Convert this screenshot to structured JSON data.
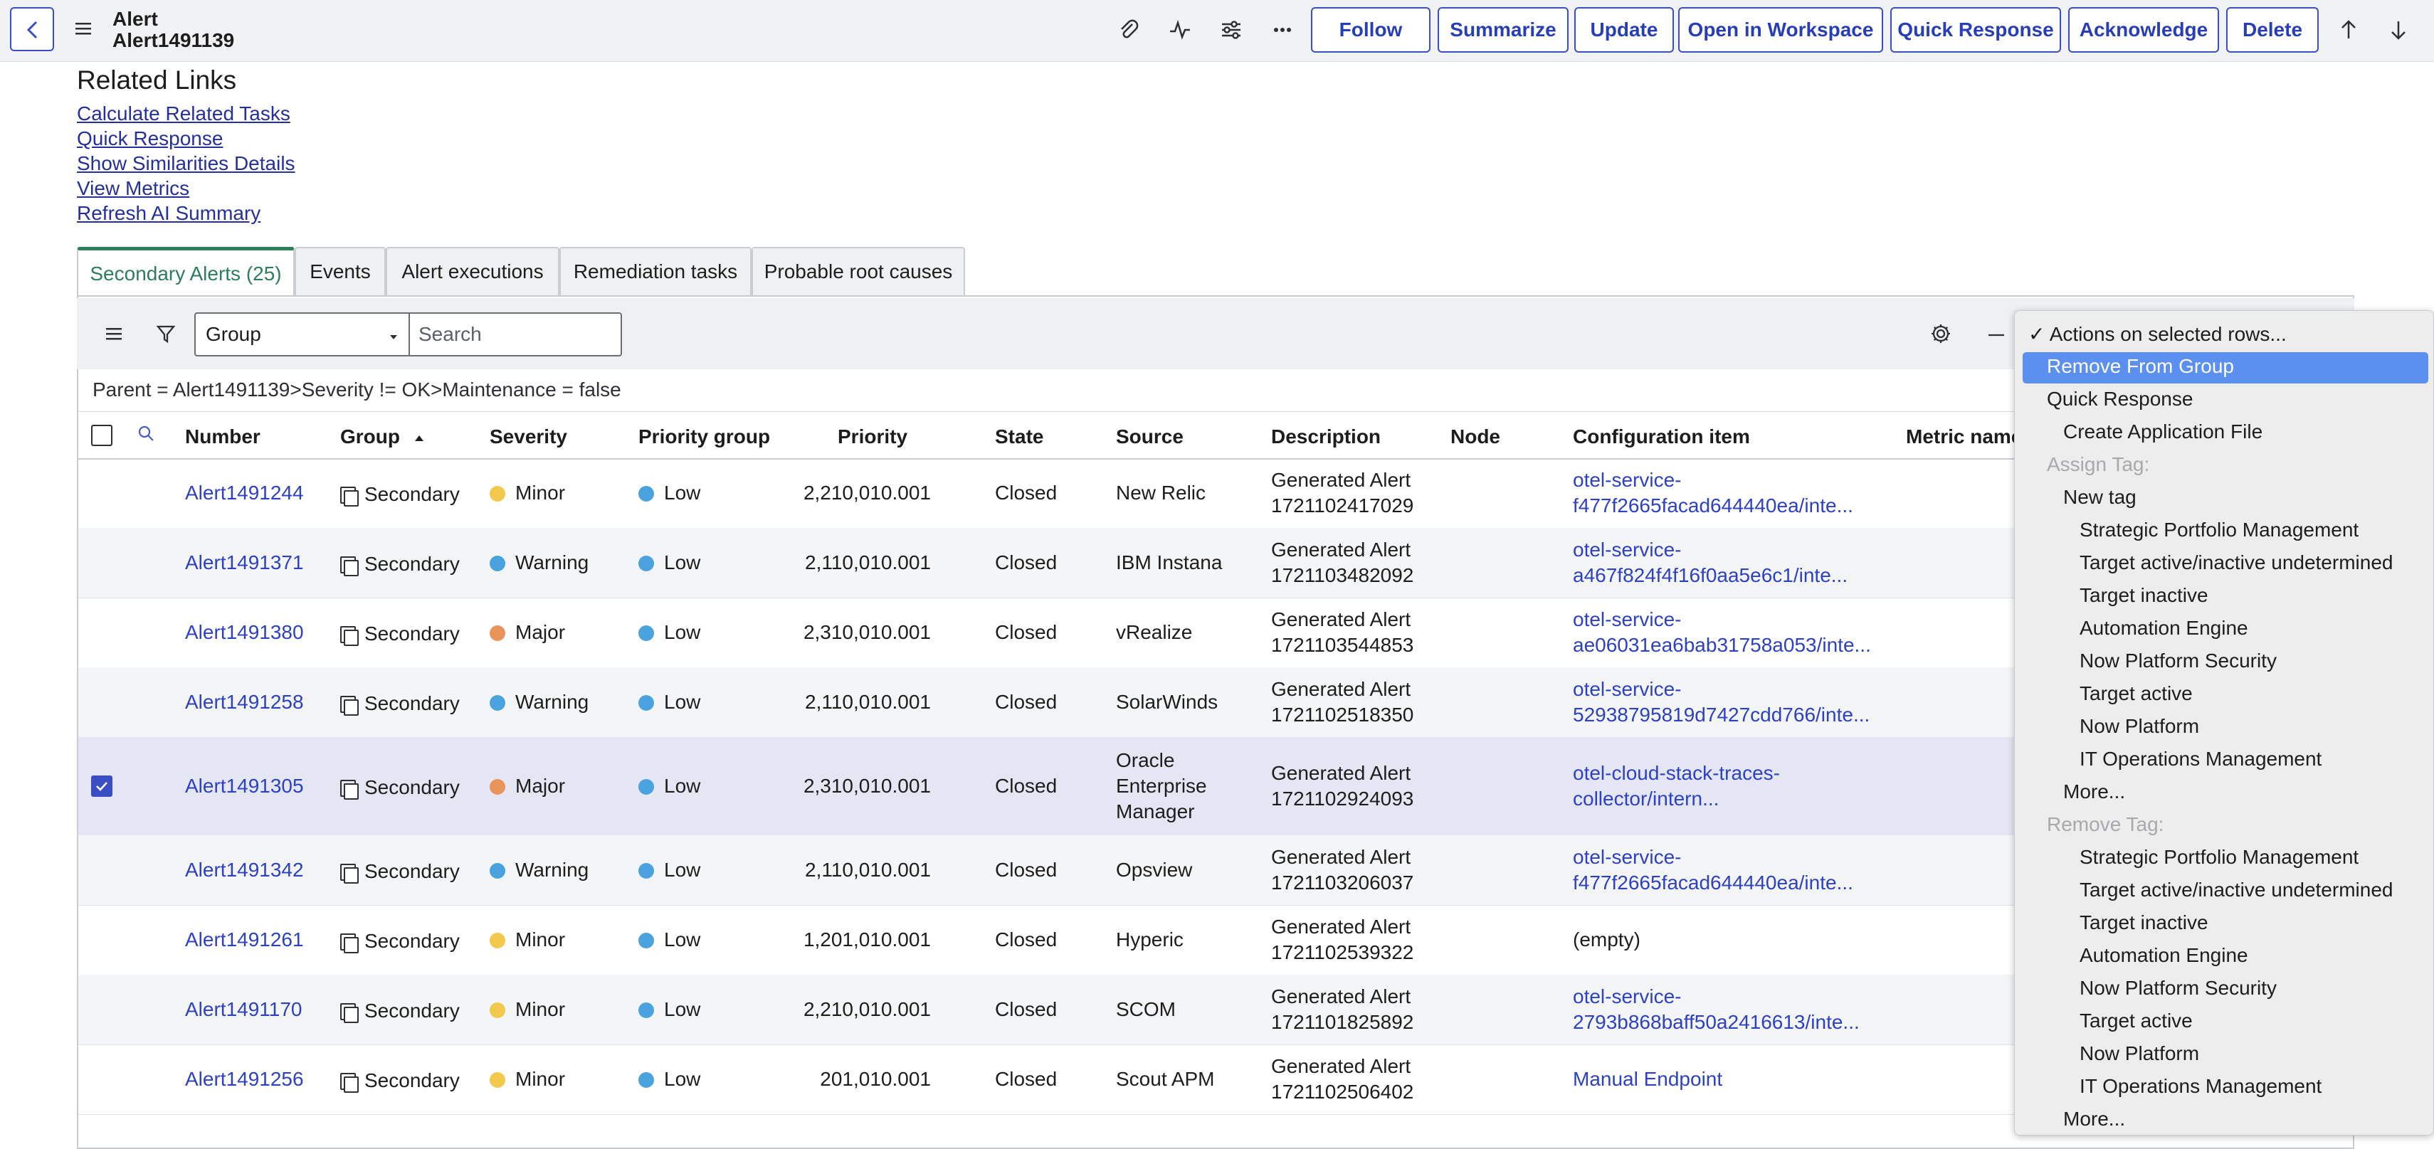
{
  "header": {
    "table_label": "Alert",
    "record_number": "Alert1491139",
    "buttons": [
      "Follow",
      "Summarize",
      "Update",
      "Open in Workspace",
      "Quick Response",
      "Acknowledge",
      "Delete"
    ]
  },
  "related_links": {
    "title": "Related Links",
    "links": [
      "Calculate Related Tasks",
      "Quick Response",
      "Show Similarities Details",
      "View Metrics",
      "Refresh AI Summary"
    ]
  },
  "tabs": [
    "Secondary Alerts (25)",
    "Events",
    "Alert executions",
    "Remediation tasks",
    "Probable root causes"
  ],
  "list": {
    "search_field": "Group",
    "search_placeholder": "Search",
    "breadcrumb": "Parent = Alert1491139>Severity != OK>Maintenance = false",
    "columns": [
      "Number",
      "Group",
      "Severity",
      "Priority group",
      "Priority",
      "State",
      "Source",
      "Description",
      "Node",
      "Configuration item",
      "Metric name"
    ],
    "rows": [
      {
        "number": "Alert1491244",
        "group": "Secondary",
        "severity": "Minor",
        "severity_color": "#f2c94c",
        "priority_group": "Low",
        "priority": "2,210,010.001",
        "state": "Closed",
        "source": [
          "New Relic"
        ],
        "description": [
          "Generated Alert",
          "1721102417029"
        ],
        "ci": [
          "otel-service-",
          "f477f2665facad644440ea/inte..."
        ],
        "ci_link": true,
        "selected": false
      },
      {
        "number": "Alert1491371",
        "group": "Secondary",
        "severity": "Warning",
        "severity_color": "#4aa3df",
        "priority_group": "Low",
        "priority": "2,110,010.001",
        "state": "Closed",
        "source": [
          "IBM Instana"
        ],
        "description": [
          "Generated Alert",
          "1721103482092"
        ],
        "ci": [
          "otel-service-",
          "a467f824f4f16f0aa5e6c1/inte..."
        ],
        "ci_link": true,
        "selected": false
      },
      {
        "number": "Alert1491380",
        "group": "Secondary",
        "severity": "Major",
        "severity_color": "#e8945a",
        "priority_group": "Low",
        "priority": "2,310,010.001",
        "state": "Closed",
        "source": [
          "vRealize"
        ],
        "description": [
          "Generated Alert",
          "1721103544853"
        ],
        "ci": [
          "otel-service-",
          "ae06031ea6bab31758a053/inte..."
        ],
        "ci_link": true,
        "selected": false
      },
      {
        "number": "Alert1491258",
        "group": "Secondary",
        "severity": "Warning",
        "severity_color": "#4aa3df",
        "priority_group": "Low",
        "priority": "2,110,010.001",
        "state": "Closed",
        "source": [
          "SolarWinds"
        ],
        "description": [
          "Generated Alert",
          "1721102518350"
        ],
        "ci": [
          "otel-service-",
          "52938795819d7427cdd766/inte..."
        ],
        "ci_link": true,
        "selected": false
      },
      {
        "number": "Alert1491305",
        "group": "Secondary",
        "severity": "Major",
        "severity_color": "#e8945a",
        "priority_group": "Low",
        "priority": "2,310,010.001",
        "state": "Closed",
        "source": [
          "Oracle",
          "Enterprise",
          "Manager"
        ],
        "description": [
          "Generated Alert",
          "1721102924093"
        ],
        "ci": [
          "otel-cloud-stack-traces-",
          "collector/intern..."
        ],
        "ci_link": true,
        "selected": true
      },
      {
        "number": "Alert1491342",
        "group": "Secondary",
        "severity": "Warning",
        "severity_color": "#4aa3df",
        "priority_group": "Low",
        "priority": "2,110,010.001",
        "state": "Closed",
        "source": [
          "Opsview"
        ],
        "description": [
          "Generated Alert",
          "1721103206037"
        ],
        "ci": [
          "otel-service-",
          "f477f2665facad644440ea/inte..."
        ],
        "ci_link": true,
        "selected": false
      },
      {
        "number": "Alert1491261",
        "group": "Secondary",
        "severity": "Minor",
        "severity_color": "#f2c94c",
        "priority_group": "Low",
        "priority": "1,201,010.001",
        "state": "Closed",
        "source": [
          "Hyperic"
        ],
        "description": [
          "Generated Alert",
          "1721102539322"
        ],
        "ci": [
          "(empty)"
        ],
        "ci_link": false,
        "selected": false
      },
      {
        "number": "Alert1491170",
        "group": "Secondary",
        "severity": "Minor",
        "severity_color": "#f2c94c",
        "priority_group": "Low",
        "priority": "2,210,010.001",
        "state": "Closed",
        "source": [
          "SCOM"
        ],
        "description": [
          "Generated Alert",
          "1721101825892"
        ],
        "ci": [
          "otel-service-",
          "2793b868baff50a2416613/inte..."
        ],
        "ci_link": true,
        "selected": false
      },
      {
        "number": "Alert1491256",
        "group": "Secondary",
        "severity": "Minor",
        "severity_color": "#f2c94c",
        "priority_group": "Low",
        "priority": "201,010.001",
        "state": "Closed",
        "source": [
          "Scout APM"
        ],
        "description": [
          "Generated Alert",
          "1721102506402"
        ],
        "ci": [
          "Manual Endpoint"
        ],
        "ci_link": true,
        "selected": false
      }
    ]
  },
  "context_menu": {
    "items": [
      {
        "label": "✓ Actions on selected rows...",
        "disabled": false,
        "indent": 0
      },
      {
        "label": "Remove From Group",
        "disabled": false,
        "indent": 1,
        "highlighted": true
      },
      {
        "label": "Quick Response",
        "disabled": false,
        "indent": 1
      },
      {
        "label": "Create Application File",
        "disabled": false,
        "indent": 2
      },
      {
        "label": "Assign Tag:",
        "disabled": true,
        "indent": 1
      },
      {
        "label": "New tag",
        "disabled": false,
        "indent": 2
      },
      {
        "label": "Strategic Portfolio Management",
        "disabled": false,
        "indent": 3
      },
      {
        "label": "Target active/inactive undetermined",
        "disabled": false,
        "indent": 3
      },
      {
        "label": "Target inactive",
        "disabled": false,
        "indent": 3
      },
      {
        "label": "Automation Engine",
        "disabled": false,
        "indent": 3
      },
      {
        "label": "Now Platform Security",
        "disabled": false,
        "indent": 3
      },
      {
        "label": "Target active",
        "disabled": false,
        "indent": 3
      },
      {
        "label": "Now Platform",
        "disabled": false,
        "indent": 3
      },
      {
        "label": "IT Operations Management",
        "disabled": false,
        "indent": 3
      },
      {
        "label": "More...",
        "disabled": false,
        "indent": 2
      },
      {
        "label": "Remove Tag:",
        "disabled": true,
        "indent": 1
      },
      {
        "label": "Strategic Portfolio Management",
        "disabled": false,
        "indent": 3
      },
      {
        "label": "Target active/inactive undetermined",
        "disabled": false,
        "indent": 3
      },
      {
        "label": "Target inactive",
        "disabled": false,
        "indent": 3
      },
      {
        "label": "Automation Engine",
        "disabled": false,
        "indent": 3
      },
      {
        "label": "Now Platform Security",
        "disabled": false,
        "indent": 3
      },
      {
        "label": "Target active",
        "disabled": false,
        "indent": 3
      },
      {
        "label": "Now Platform",
        "disabled": false,
        "indent": 3
      },
      {
        "label": "IT Operations Management",
        "disabled": false,
        "indent": 3
      },
      {
        "label": "More...",
        "disabled": false,
        "indent": 2
      }
    ]
  }
}
